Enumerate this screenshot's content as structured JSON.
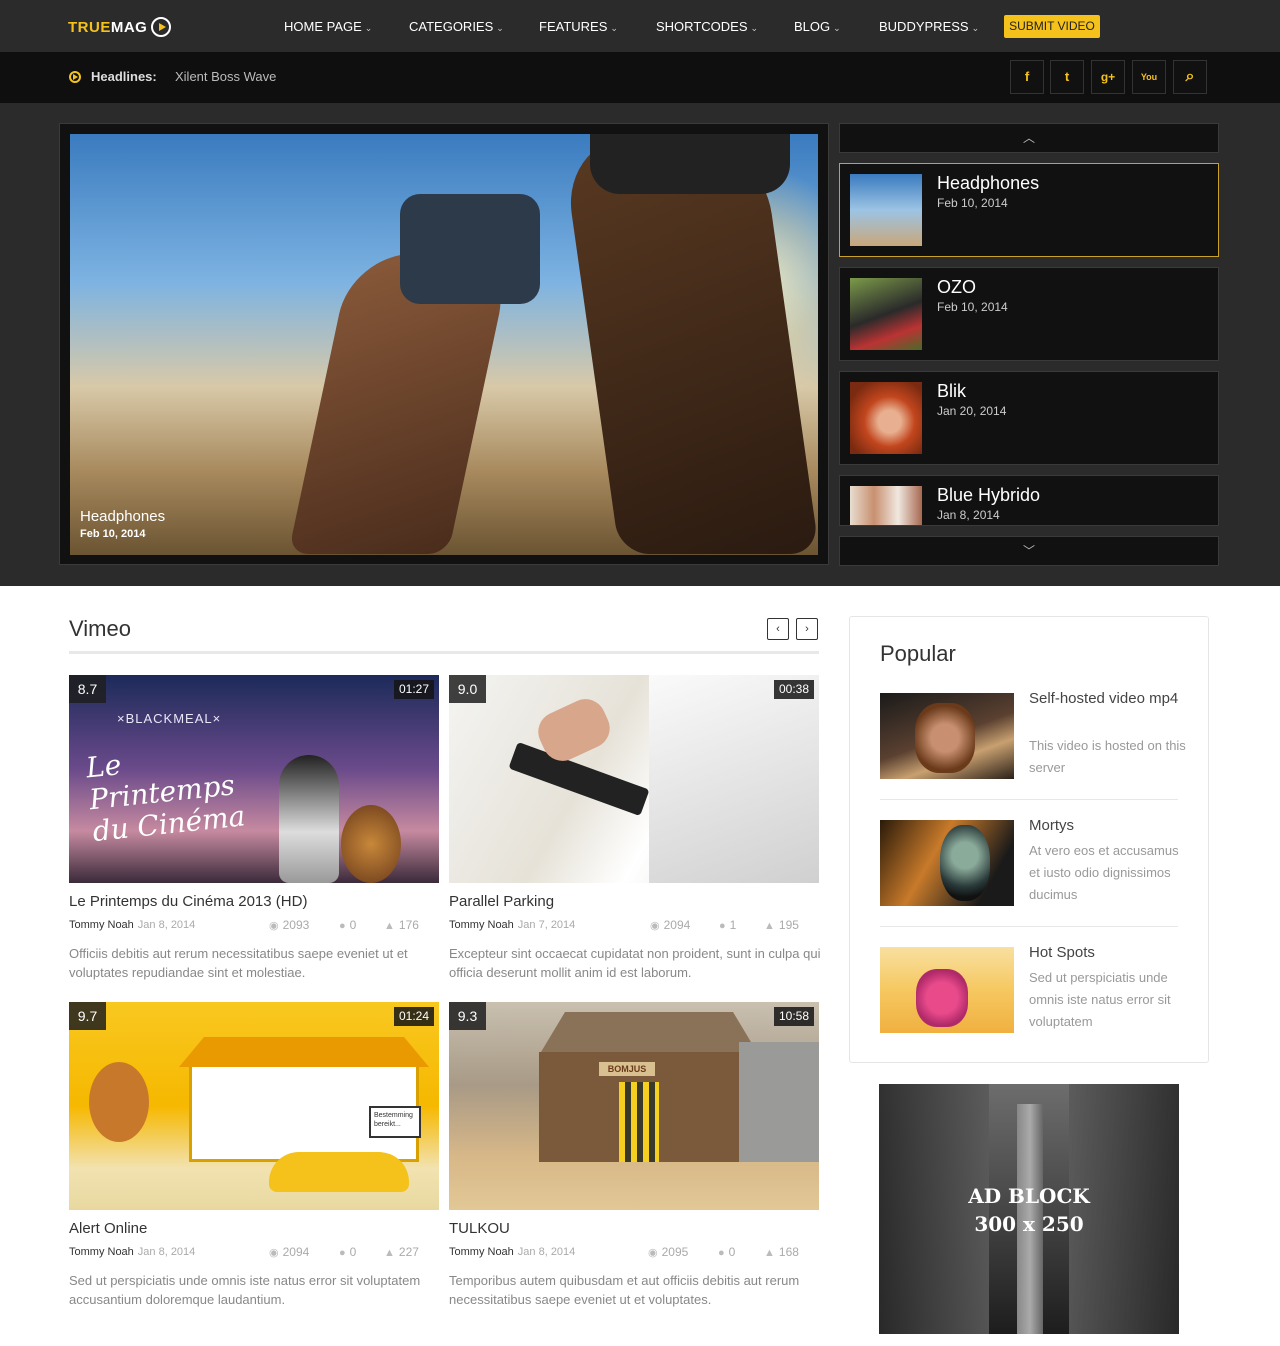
{
  "nav": {
    "logo_part1": "TRUE",
    "logo_part2": "MAG",
    "items": [
      {
        "label": "HOME PAGE"
      },
      {
        "label": "CATEGORIES"
      },
      {
        "label": "FEATURES"
      },
      {
        "label": "SHORTCODES"
      },
      {
        "label": "BLOG"
      },
      {
        "label": "BUDDYPRESS"
      }
    ],
    "submit_label": "SUBMIT VIDEO"
  },
  "headlines": {
    "label": "Headlines:",
    "text": "Xilent Boss Wave"
  },
  "social": {
    "facebook": "f",
    "twitter": "t",
    "googleplus": "g+",
    "youtube": "You",
    "search": "⌕"
  },
  "slider": {
    "main_title": "Headphones",
    "main_date": "Feb 10, 2014",
    "up_arrow": "︿",
    "down_arrow": "﹀",
    "items": [
      {
        "title": "Headphones",
        "date": "Feb 10, 2014"
      },
      {
        "title": "OZO",
        "date": "Feb 10, 2014"
      },
      {
        "title": "Blik",
        "date": "Jan 20, 2014"
      },
      {
        "title": "Blue Hybrido",
        "date": "Jan 8, 2014"
      }
    ]
  },
  "vimeo": {
    "title": "Vimeo",
    "prev": "‹",
    "next": "›",
    "cards": [
      {
        "rating": "8.7",
        "duration": "01:27",
        "title": "Le Printemps du Cinéma 2013 (HD)",
        "author": "Tommy Noah",
        "date": "Jan 8, 2014",
        "views": "2093",
        "comments": "0",
        "likes": "176",
        "desc": "Officiis debitis aut rerum necessitatibus saepe eveniet ut et voluptates repudiandae sint et molestiae.",
        "img_text1": "×BLACKMEAL×",
        "img_text2": "Le Printemps du Cinéma"
      },
      {
        "rating": "9.0",
        "duration": "00:38",
        "title": "Parallel Parking",
        "author": "Tommy Noah",
        "date": "Jan 7, 2014",
        "views": "2094",
        "comments": "1",
        "likes": "195",
        "desc": "Excepteur sint occaecat cupidatat non proident, sunt in culpa qui officia deserunt mollit anim id est laborum."
      },
      {
        "rating": "9.7",
        "duration": "01:24",
        "title": "Alert Online",
        "author": "Tommy Noah",
        "date": "Jan 8, 2014",
        "views": "2094",
        "comments": "0",
        "likes": "227",
        "desc": "Sed ut perspiciatis unde omnis iste natus error sit voluptatem accusantium doloremque laudantium.",
        "img_text": "Bestemming bereikt..."
      },
      {
        "rating": "9.3",
        "duration": "10:58",
        "title": "TULKOU",
        "author": "Tommy Noah",
        "date": "Jan 8, 2014",
        "views": "2095",
        "comments": "0",
        "likes": "168",
        "desc": "Temporibus autem quibusdam et aut officiis debitis aut rerum necessitatibus saepe eveniet ut et voluptates.",
        "img_text": "BOMJUS"
      }
    ]
  },
  "popular": {
    "title": "Popular",
    "items": [
      {
        "title": "Self-hosted video mp4",
        "desc": "This video is hosted on this server"
      },
      {
        "title": "Mortys",
        "desc": "At vero eos et accusamus et iusto odio dignissimos ducimus"
      },
      {
        "title": "Hot Spots",
        "desc": "Sed ut perspiciatis unde omnis iste natus error sit voluptatem"
      }
    ]
  },
  "ad": {
    "line1": "AD BLOCK",
    "line2": "300 x 250"
  },
  "colors": {
    "accent": "#f5c21b",
    "nav_bg": "#2b2b2b",
    "headline_bg": "#0f0f0f"
  }
}
